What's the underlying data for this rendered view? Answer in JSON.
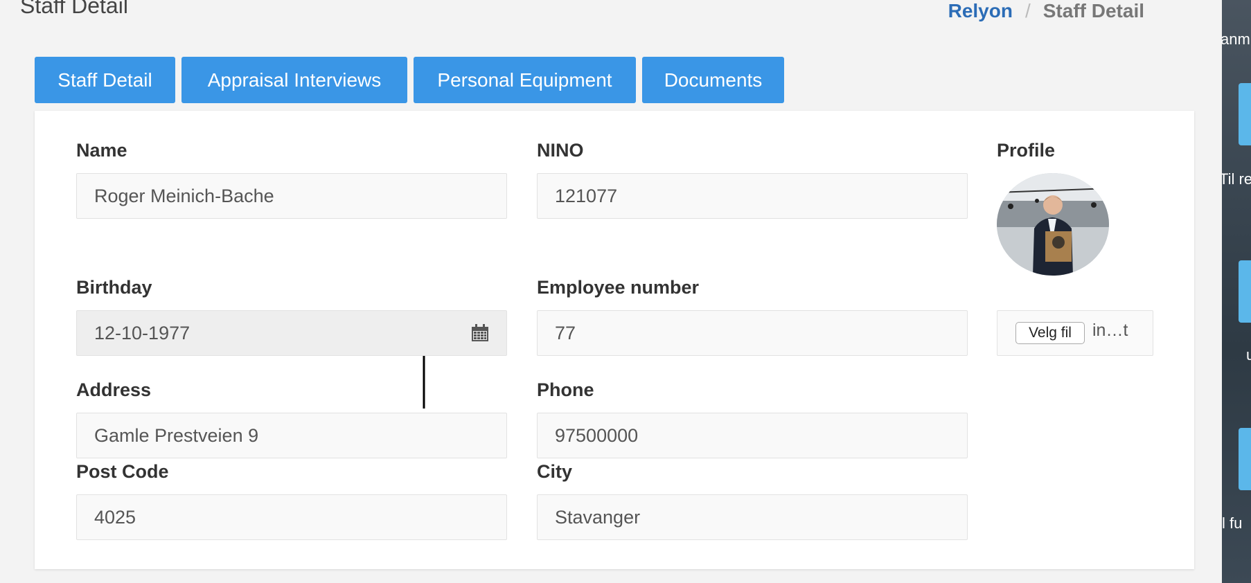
{
  "header": {
    "title": "Staff Detail",
    "breadcrumb": {
      "home": "Relyon",
      "separator": "/",
      "current": "Staff Detail"
    }
  },
  "tabs": [
    {
      "label": "Staff Detail"
    },
    {
      "label": "Appraisal Interviews"
    },
    {
      "label": "Personal Equipment"
    },
    {
      "label": "Documents"
    }
  ],
  "form": {
    "name": {
      "label": "Name",
      "value": "Roger Meinich-Bache"
    },
    "nino": {
      "label": "NINO",
      "value": "121077"
    },
    "profile": {
      "label": "Profile",
      "file_button": "Velg fil",
      "file_name": "in…t"
    },
    "birthday": {
      "label": "Birthday",
      "value": "12-10-1977",
      "icon": "calendar-icon"
    },
    "employee_number": {
      "label": "Employee number",
      "value": "77"
    },
    "address": {
      "label": "Address",
      "value": "Gamle Prestveien 9"
    },
    "phone": {
      "label": "Phone",
      "value": "97500000"
    },
    "post_code": {
      "label": "Post Code",
      "value": "4025"
    },
    "city": {
      "label": "City",
      "value": "Stavanger"
    }
  },
  "desktop": {
    "labels": [
      "anm",
      "Til re",
      "u",
      "l fu"
    ]
  },
  "colors": {
    "tab": "#3a96e6",
    "link": "#2b6cb6",
    "background": "#f3f3f3"
  }
}
